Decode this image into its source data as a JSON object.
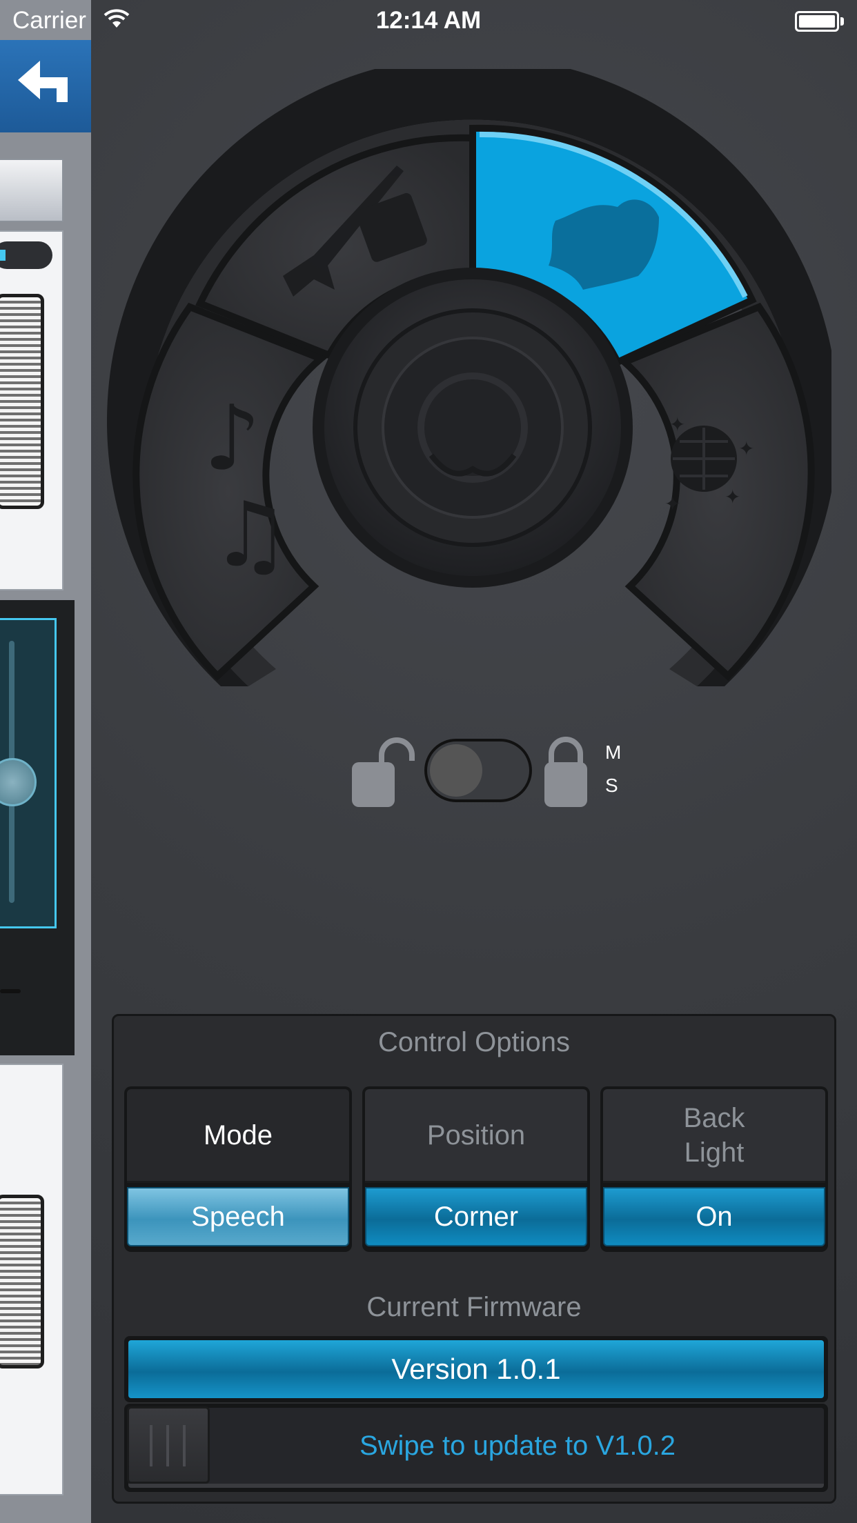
{
  "status_bar": {
    "carrier": "Carrier",
    "time": "12:14 AM"
  },
  "colors": {
    "accent": "#0aa3df",
    "background": "#3a3c40",
    "panel": "#2b2c2f"
  },
  "mode_dial": {
    "segments": [
      {
        "icon": "guitar-amp-icon",
        "selected": false
      },
      {
        "icon": "map-icon",
        "selected": true
      },
      {
        "icon": "disco-ball-icon",
        "selected": false
      },
      {
        "icon": "music-notes-icon",
        "selected": false
      }
    ],
    "center": "power-icon"
  },
  "lock_toggle": {
    "state": "unlocked",
    "label_m": "M",
    "label_s": "S"
  },
  "control_options": {
    "title": "Control Options",
    "options": [
      {
        "label": "Mode",
        "value": "Speech"
      },
      {
        "label": "Position",
        "value": "Corner"
      },
      {
        "label": "Back Light",
        "value": "On"
      }
    ]
  },
  "firmware": {
    "title": "Current Firmware",
    "version": "Version 1.0.1",
    "swipe_text": "Swipe to update to V1.0.2"
  }
}
